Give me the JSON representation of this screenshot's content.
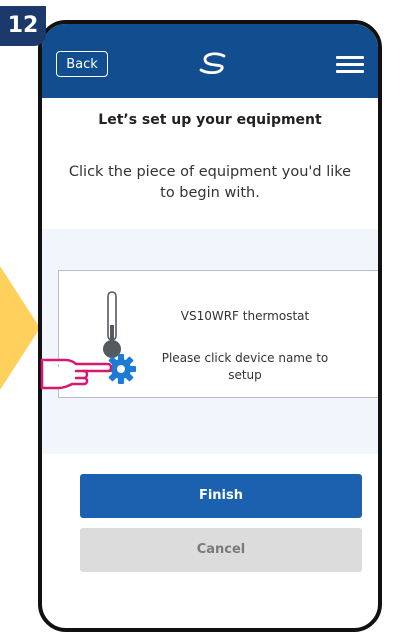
{
  "step_badge": "12",
  "header": {
    "back_label": "Back",
    "logo_icon": "brand-s-logo-icon",
    "menu_icon": "hamburger-menu-icon",
    "bg_color": "#124e8f"
  },
  "main": {
    "title": "Let’s set up your equipment",
    "instruction": "Click the piece of equipment you'd like to begin with.",
    "device": {
      "name": "VS10WRF thermostat",
      "hint": "Please click device name to setup",
      "icons": [
        "thermometer-icon",
        "gear-icon"
      ]
    }
  },
  "actions": {
    "finish_label": "Finish",
    "cancel_label": "Cancel",
    "finish_color": "#1b61b0"
  }
}
